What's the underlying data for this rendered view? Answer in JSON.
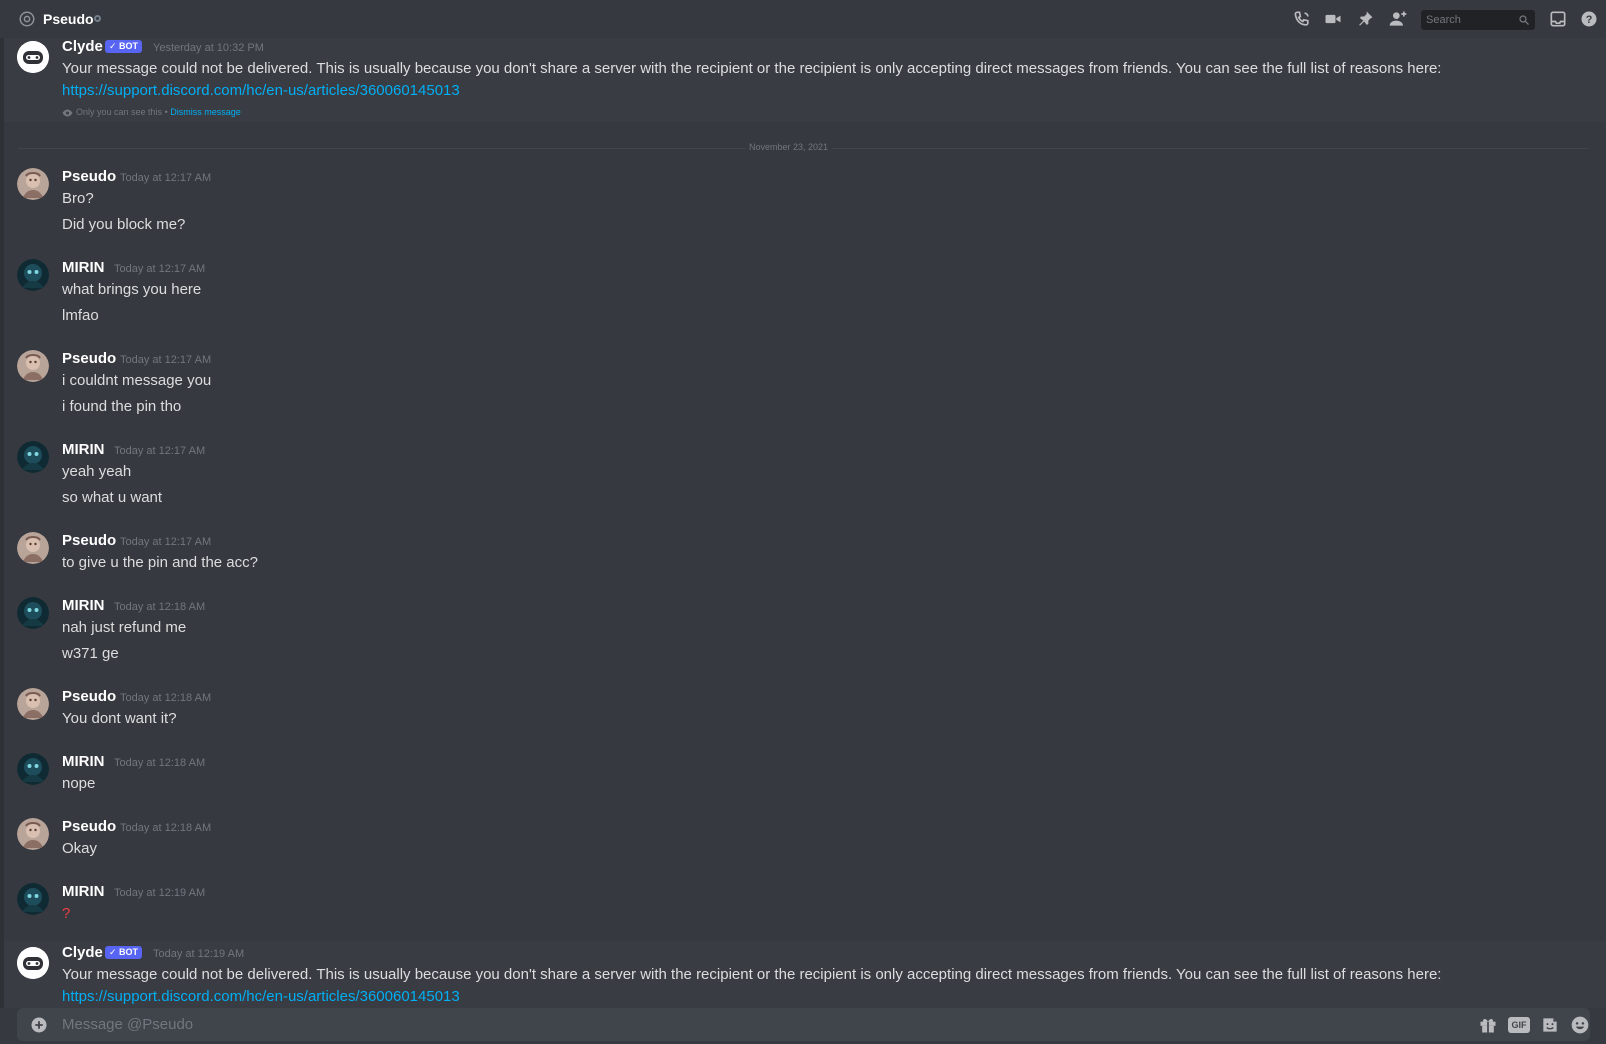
{
  "header": {
    "channel_name": "Pseudo",
    "search_placeholder": "Search",
    "icons": [
      "at-icon",
      "call-icon",
      "video-icon",
      "pin-icon",
      "add-friend-icon",
      "search-icon",
      "inbox-icon",
      "help-icon"
    ]
  },
  "clyde_message_1": {
    "username": "Clyde",
    "bot_tag": "✓ BOT",
    "timestamp": "Yesterday at 10:32 PM",
    "text": "Your message could not be delivered. This is usually because you don't share a server with the recipient or the recipient is only accepting direct messages from friends. You can see the full list of reasons here:",
    "link": "https://support.discord.com/hc/en-us/articles/360060145013",
    "notice": "Only you can see this",
    "notice_sep": "•",
    "dismiss": "Dismiss message"
  },
  "date_divider": "November 23, 2021",
  "messages": [
    {
      "username": "Pseudo",
      "timestamp": "Today at 12:17 AM",
      "lines": [
        "Bro?",
        "Did you block me?"
      ]
    },
    {
      "username": "MIRIN",
      "timestamp": "Today at 12:17 AM",
      "lines": [
        "what brings you here",
        "lmfao"
      ]
    },
    {
      "username": "Pseudo",
      "timestamp": "Today at 12:17 AM",
      "lines": [
        "i couldnt message you",
        "i found the pin tho"
      ]
    },
    {
      "username": "MIRIN",
      "timestamp": "Today at 12:17 AM",
      "lines": [
        "yeah yeah",
        "so what u want"
      ]
    },
    {
      "username": "Pseudo",
      "timestamp": "Today at 12:17 AM",
      "lines": [
        "to give u the pin and the acc?"
      ]
    },
    {
      "username": "MIRIN",
      "timestamp": "Today at 12:18 AM",
      "lines": [
        "nah just refund me",
        "w371 ge"
      ]
    },
    {
      "username": "Pseudo",
      "timestamp": "Today at 12:18 AM",
      "lines": [
        "You dont want it?"
      ]
    },
    {
      "username": "MIRIN",
      "timestamp": "Today at 12:18 AM",
      "lines": [
        "nope"
      ]
    },
    {
      "username": "Pseudo",
      "timestamp": "Today at 12:18 AM",
      "lines": [
        "Okay"
      ]
    },
    {
      "username": "MIRIN",
      "timestamp": "Today at 12:19 AM",
      "lines": [
        "?"
      ]
    }
  ],
  "clyde_message_2": {
    "username": "Clyde",
    "bot_tag": "✓ BOT",
    "timestamp": "Today at 12:19 AM",
    "text": "Your message could not be delivered. This is usually because you don't share a server with the recipient or the recipient is only accepting direct messages from friends. You can see the full list of reasons here:",
    "link": "https://support.discord.com/hc/en-us/articles/360060145013"
  },
  "composer": {
    "placeholder": "Message @Pseudo",
    "gif_label": "GIF"
  },
  "colors": {
    "background": "#36393f",
    "ephemeral_bg": "#393c43",
    "blurple": "#5865f2",
    "link": "#00aff4",
    "muted": "#72767d",
    "text": "#dcddde",
    "question_mark": "#ed4245"
  }
}
